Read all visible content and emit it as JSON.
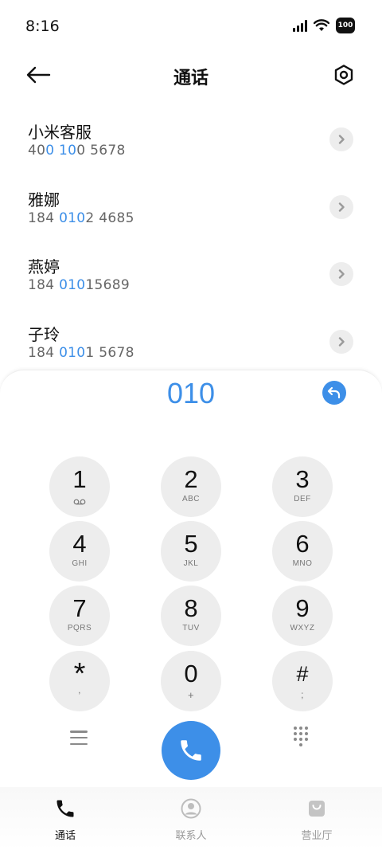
{
  "status_bar": {
    "time": "8:16",
    "badge": "100"
  },
  "header": {
    "title": "通话"
  },
  "contacts": [
    {
      "name": "小米客服",
      "number_parts": [
        "400",
        " 100",
        " 5678"
      ],
      "pre": "40",
      "hl": "0 10",
      "post": "0 5678"
    },
    {
      "name": "雅娜",
      "pre": "184 ",
      "hl": "010",
      "post": "2 4685"
    },
    {
      "name": "燕婷",
      "pre": "184 ",
      "hl": "010",
      "post": "15689"
    },
    {
      "name": "子玲",
      "pre": "184 ",
      "hl": "010",
      "post": "1 5678"
    }
  ],
  "dialer": {
    "dialed": "010",
    "keys": [
      {
        "digit": "1",
        "letters": "voicemail"
      },
      {
        "digit": "2",
        "letters": "ABC"
      },
      {
        "digit": "3",
        "letters": "DEF"
      },
      {
        "digit": "4",
        "letters": "GHI"
      },
      {
        "digit": "5",
        "letters": "JKL"
      },
      {
        "digit": "6",
        "letters": "MNO"
      },
      {
        "digit": "7",
        "letters": "PQRS"
      },
      {
        "digit": "8",
        "letters": "TUV"
      },
      {
        "digit": "9",
        "letters": "WXYZ"
      },
      {
        "digit": "*",
        "letters": ","
      },
      {
        "digit": "0",
        "letters": "+"
      },
      {
        "digit": "#",
        "letters": ";"
      }
    ]
  },
  "bottom_nav": [
    {
      "label": "通话",
      "icon": "phone-icon",
      "active": true
    },
    {
      "label": "联系人",
      "icon": "person-icon",
      "active": false
    },
    {
      "label": "营业厅",
      "icon": "bag-icon",
      "active": false
    }
  ],
  "colors": {
    "accent": "#3d8fe8",
    "key_bg": "#ededed"
  }
}
